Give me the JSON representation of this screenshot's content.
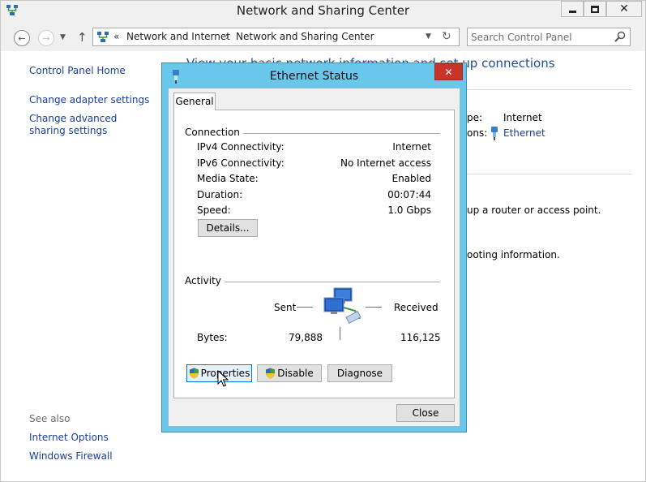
{
  "window": {
    "title": "Network and Sharing Center",
    "controls": {
      "minimize_icon": "minimize-icon",
      "maximize_icon": "maximize-icon",
      "close_label": "✕"
    }
  },
  "nav": {
    "back_icon": "back-arrow-icon",
    "forward_icon": "forward-arrow-icon",
    "up_icon": "up-arrow-icon",
    "breadcrumb_prefix": "«",
    "breadcrumb": [
      "Network and Internet",
      "Network and Sharing Center"
    ],
    "breadcrumb_separator": "›",
    "refresh_icon": "refresh-icon",
    "search_placeholder": "Search Control Panel"
  },
  "sidebar": {
    "links": [
      "Control Panel Home",
      "Change adapter settings",
      "Change advanced sharing settings"
    ],
    "see_also_label": "See also",
    "see_also_links": [
      "Internet Options",
      "Windows Firewall"
    ]
  },
  "background": {
    "heading": "View your basic network information and set up connections",
    "access_type_label": "pe:",
    "access_type_value": "Internet",
    "connections_label": "ons:",
    "connections_value": "Ethernet",
    "router_text": "up a router or access point.",
    "troubleshoot_text": "ooting information."
  },
  "dialog": {
    "title": "Ethernet Status",
    "close_label": "✕",
    "tab": "General",
    "connection_group": "Connection",
    "stats": [
      {
        "label": "IPv4 Connectivity:",
        "value": "Internet"
      },
      {
        "label": "IPv6 Connectivity:",
        "value": "No Internet access"
      },
      {
        "label": "Media State:",
        "value": "Enabled"
      },
      {
        "label": "Duration:",
        "value": "00:07:44"
      },
      {
        "label": "Speed:",
        "value": "1.0 Gbps"
      }
    ],
    "details_button": "Details...",
    "activity_group": "Activity",
    "sent_label": "Sent",
    "received_label": "Received",
    "bytes_label": "Bytes:",
    "sent_bytes": "79,888",
    "received_bytes": "116,125",
    "properties_button": "Properties",
    "disable_button": "Disable",
    "diagnose_button": "Diagnose",
    "close_button": "Close"
  },
  "colors": {
    "link": "#1a3f9b",
    "dialog_frame": "#69c7ec",
    "dialog_close": "#c7352a",
    "heading": "#1e4e9e"
  }
}
